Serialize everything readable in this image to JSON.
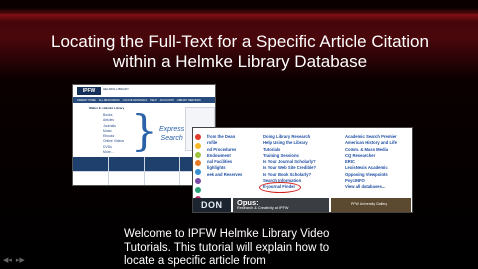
{
  "slide": {
    "title_line1": "Locating the Full-Text for a Specific Article Citation",
    "title_line2": "within a Helmke Library Database",
    "caption_line1": "Welcome to IPFW Helmke Library Video",
    "caption_line2": "Tutorials.  This tutorial will explain how to",
    "caption_line3": "locate a specific article from"
  },
  "left_screenshot": {
    "logo": "IPFW",
    "library_name": "HELMKE LIBRARY",
    "nav": [
      "LIBRARY HOME",
      "ALL RESOURCES",
      "LOCATE MATERIALS",
      "HELP",
      "ACCOUNTS",
      "LIBRARY SERVICES"
    ],
    "banner": "Walter E. Helmke Library",
    "resources": [
      "Books",
      "Articles",
      "Journals",
      "Music",
      "Ebooks",
      "Online Videos",
      "DVDs",
      "More..."
    ],
    "express_line1": "Express",
    "express_line2": "Search"
  },
  "right_screenshot": {
    "col1": [
      "from the Dean",
      "rofile",
      "nd Procedures",
      "",
      "Endowment",
      "nal Facilities",
      "lighlights",
      "eek and Reserves"
    ],
    "col2": [
      "Doing Library Research",
      "Help Using the Library",
      "Tutorials",
      "Training Sessions",
      "Is Your Journal Scholarly?",
      "Is Your Web Site Credible?",
      "Is Your Book Scholarly?",
      "Search Information",
      "E-journal Finder"
    ],
    "col3": [
      "Academic Search Premier",
      "American History and Life",
      "Comm. & Mass Media",
      "CQ Researcher",
      "ERIC",
      "LexisNexis Academic",
      "Opposing Viewpoints",
      "PsycINFO",
      "View all databases..."
    ],
    "dot_colors": [
      "#e03a2a",
      "#f6b824",
      "#9dc43b",
      "#e87a24",
      "#3a8fd0",
      "#7a4aa8",
      "#2aa07a",
      "#c02a6a"
    ],
    "promo_dark": "DON",
    "promo_opus_title": "Opus:",
    "promo_opus_sub": "Research & Creativity at IPFW",
    "promo_gallery": "PFW University Gallery"
  },
  "controls": {
    "prev_icon": "◀◂",
    "next_icon": "▸▶"
  }
}
